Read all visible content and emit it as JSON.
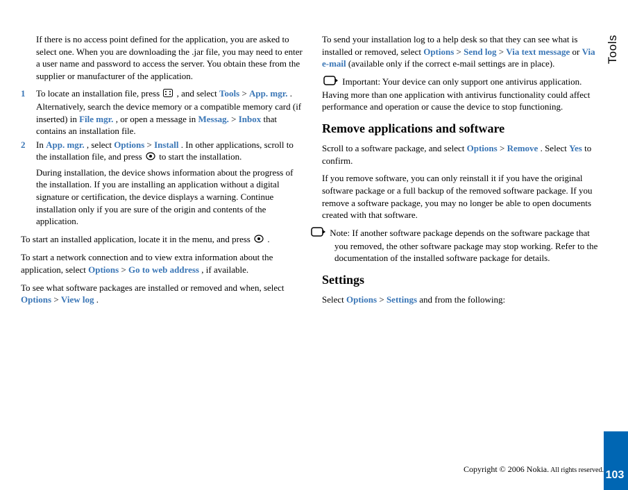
{
  "sidebar": {
    "label": "Tools"
  },
  "pageNumber": "103",
  "footer": {
    "main": "Copyright © 2006 Nokia.",
    "sub": " All rights reserved."
  },
  "left": {
    "p1_a": "If there is no access point defined for the application, you are asked to select one. When you are downloading the .jar file, you may need to enter a user name and password to access the server. You obtain these from the supplier or manufacturer of the application.",
    "step1": {
      "num": "1",
      "a": "To locate an installation file, press ",
      "b": " , and select ",
      "tools": "Tools",
      "gt1": " > ",
      "appmgr": "App. mgr.",
      "c": ". Alternatively, search the device memory or a compatible memory card (if inserted) in ",
      "filemgr": "File mgr.",
      "d": ", or open a message in ",
      "messag": "Messag.",
      "gt2": " > ",
      "inbox": "Inbox",
      "e": " that contains an installation file."
    },
    "step2": {
      "num": "2",
      "a": "In ",
      "appmgr": "App. mgr.",
      "b": ", select ",
      "options": "Options",
      "gt1": " > ",
      "install": "Install",
      "c": ". In other applications, scroll to the installation file, and press ",
      "d": " to start the installation.",
      "e": "During installation, the device shows information about the progress of the installation. If you are installing an application without a digital signature or certification, the device displays a warning. Continue installation only if you are sure of the origin and contents of the application."
    },
    "p2_a": "To start an installed application, locate it in the menu, and press ",
    "p2_b": ".",
    "p3_a": "To start a network connection and to view extra information about the application, select ",
    "p3_opts": "Options",
    "p3_gt": " > ",
    "p3_goto": "Go to web address",
    "p3_b": ", if available.",
    "p4_a": "To see what software packages are installed or removed and when, select ",
    "p4_opts": "Options",
    "p4_gt": " > ",
    "p4_viewlog": "View log",
    "p4_b": "."
  },
  "right": {
    "p1_a": "To send your installation log to a help desk so that they can see what is installed or removed, select ",
    "p1_opts": "Options",
    "p1_gt1": " > ",
    "p1_sendlog": "Send log",
    "p1_gt2": " > ",
    "p1_viatext": "Via text message",
    "p1_or": " or ",
    "p1_viaemail": "Via e-mail",
    "p1_b": " (available only if the correct e-mail settings are in place).",
    "p2": " Important: Your device can only support one antivirus application. Having more than one application with antivirus functionality could affect performance and operation or cause the device to stop functioning.",
    "h2_remove": "Remove applications and software",
    "p3_a": "Scroll to a software package, and select ",
    "p3_opts": "Options",
    "p3_gt": " > ",
    "p3_remove": "Remove",
    "p3_b": ". Select ",
    "p3_yes": "Yes",
    "p3_c": " to confirm.",
    "p4": "If you remove software, you can only reinstall it if you have the original software package or a full backup of the removed software package. If you remove a software package, you may no longer be able to open documents created with that software.",
    "p5": " Note: If another software package depends on the software package that you removed, the other software package may stop working. Refer to the documentation of the installed software package for details.",
    "h2_settings": "Settings",
    "p6_a": "Select ",
    "p6_opts": "Options",
    "p6_gt": " > ",
    "p6_settings": "Settings",
    "p6_b": " and from the following:"
  }
}
